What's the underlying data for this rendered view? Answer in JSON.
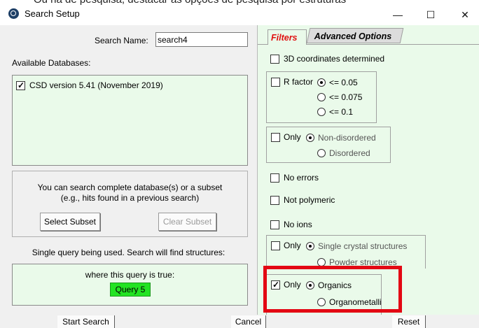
{
  "window": {
    "title": "Search Setup",
    "clipped_background_text": "Ou na de pesquisa, destacar as opções de pesquisa por estruturas"
  },
  "search": {
    "name_label": "Search Name:",
    "name_value": "search4"
  },
  "databases": {
    "label": "Available Databases:",
    "items": [
      {
        "label": "CSD version 5.41 (November 2019)",
        "checked": true
      }
    ]
  },
  "subset": {
    "text_line1": "You can search complete database(s) or a subset",
    "text_line2": "(e.g., hits found in a previous search)",
    "select_label": "Select Subset",
    "clear_label": "Clear Subset"
  },
  "query": {
    "intro": "Single query being used. Search will find structures:",
    "condition": "where this query is true:",
    "name": "Query 5"
  },
  "tabs": {
    "filters": "Filters",
    "advanced": "Advanced Options"
  },
  "filters": {
    "coords": {
      "label": "3D coordinates determined",
      "checked": false
    },
    "rfactor": {
      "label": "R factor",
      "checked": false,
      "options": [
        "<= 0.05",
        "<= 0.075",
        "<= 0.1"
      ],
      "selected": 0
    },
    "disorder": {
      "label": "Only",
      "checked": false,
      "options": [
        "Non-disordered",
        "Disordered"
      ],
      "selected": 0
    },
    "no_errors": {
      "label": "No errors",
      "checked": false
    },
    "not_polymeric": {
      "label": "Not polymeric",
      "checked": false
    },
    "no_ions": {
      "label": "No ions",
      "checked": false
    },
    "crystal": {
      "label": "Only",
      "checked": false,
      "options": [
        "Single crystal structures",
        "Powder structures"
      ],
      "selected": 0
    },
    "organics": {
      "label": "Only",
      "checked": true,
      "options": [
        "Organics",
        "Organometallic"
      ],
      "selected": 0
    }
  },
  "footer": {
    "start": "Start Search",
    "cancel": "Cancel",
    "reset": "Reset"
  },
  "colors": {
    "highlight": "#e30613",
    "panel_green": "#eafaea",
    "query_green": "#22e322",
    "active_tab": "#e01010"
  }
}
